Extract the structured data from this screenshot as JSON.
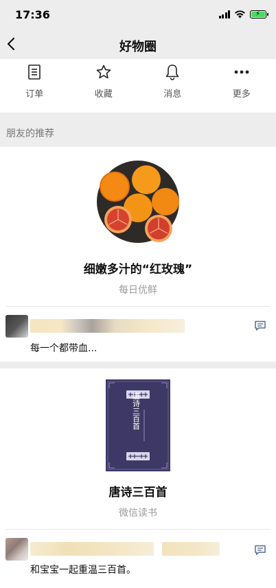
{
  "status_bar": {
    "time": "17:36"
  },
  "nav": {
    "title": "好物圈"
  },
  "actions": [
    {
      "label": "订单",
      "icon": "order-icon"
    },
    {
      "label": "收藏",
      "icon": "star-icon"
    },
    {
      "label": "消息",
      "icon": "bell-icon"
    },
    {
      "label": "更多",
      "icon": "more-icon"
    }
  ],
  "feed": {
    "section_title": "朋友的推荐",
    "items": [
      {
        "product_name": "细嫩多汁的“红玫瑰”",
        "source": "每日优鲜",
        "comment": "每一个都带血..."
      },
      {
        "product_name": "唐诗三百首",
        "source": "微信读书",
        "comment": "和宝宝一起重温三百首。",
        "book_cover_title": "唐诗三百首"
      }
    ]
  },
  "colors": {
    "background": "#ededed",
    "battery": "#4cd964",
    "accent": "#576b95",
    "book": "#3e3866"
  }
}
